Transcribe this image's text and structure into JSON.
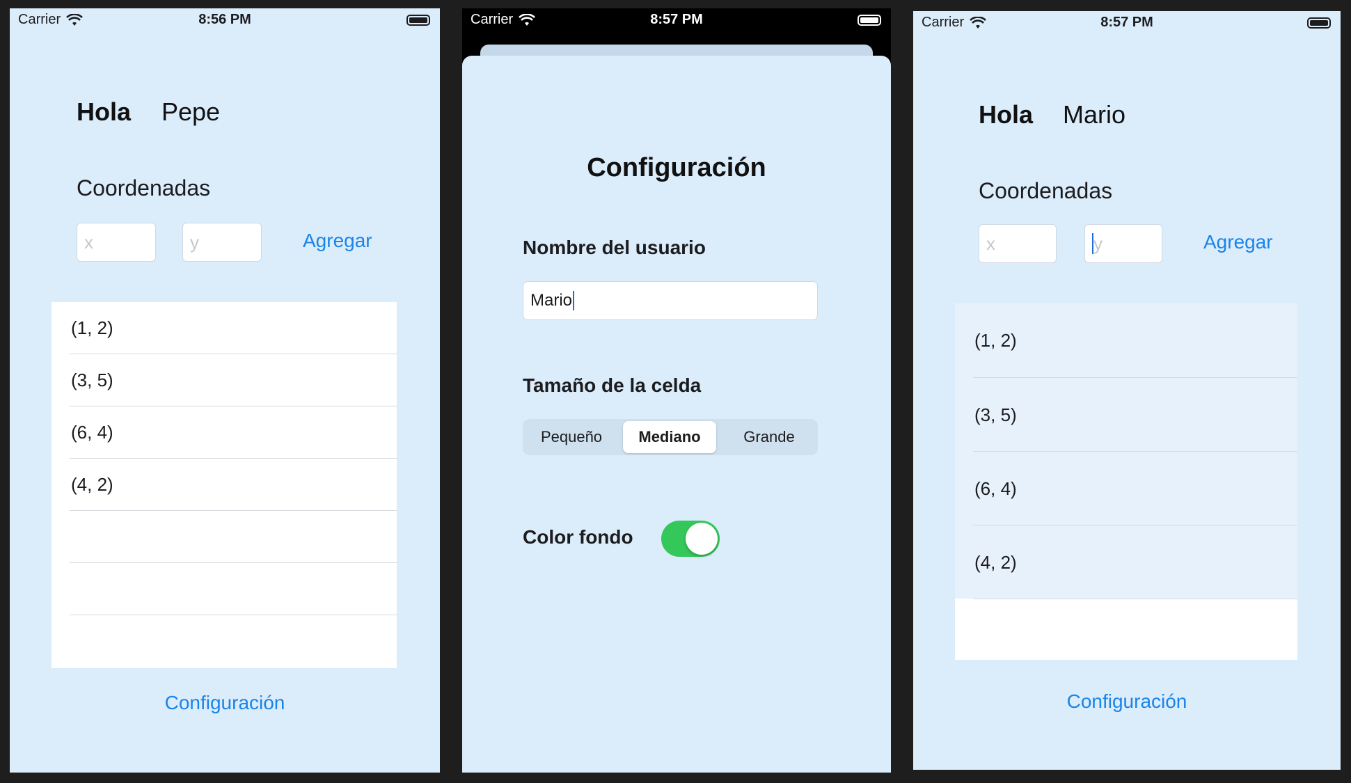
{
  "screens": [
    {
      "status": {
        "carrier": "Carrier",
        "time": "8:56 PM"
      },
      "greeting": {
        "hello": "Hola",
        "name": "Pepe"
      },
      "coords_label": "Coordenadas",
      "x_placeholder": "x",
      "y_placeholder": "y",
      "add_label": "Agregar",
      "rows": [
        "(1, 2)",
        "(3, 5)",
        "(6, 4)",
        "(4, 2)"
      ],
      "config_link": "Configuración"
    },
    {
      "status": {
        "carrier": "Carrier",
        "time": "8:57 PM"
      },
      "title": "Configuración",
      "username_label": "Nombre del usuario",
      "username_value": "Mario",
      "cell_size_label": "Tamaño de la celda",
      "segments": [
        "Pequeño",
        "Mediano",
        "Grande"
      ],
      "selected_segment": "Mediano",
      "bg_color_label": "Color fondo",
      "bg_color_on": true
    },
    {
      "status": {
        "carrier": "Carrier",
        "time": "8:57 PM"
      },
      "greeting": {
        "hello": "Hola",
        "name": "Mario"
      },
      "coords_label": "Coordenadas",
      "x_placeholder": "x",
      "y_placeholder": "y",
      "add_label": "Agregar",
      "rows": [
        "(1, 2)",
        "(3, 5)",
        "(6, 4)",
        "(4, 2)"
      ],
      "config_link": "Configuración"
    }
  ],
  "colors": {
    "screen_bg": "#dbecfb",
    "link_blue": "#1a84e8",
    "toggle_green": "#34c759"
  },
  "icons": [
    "wifi-icon",
    "battery-icon"
  ]
}
